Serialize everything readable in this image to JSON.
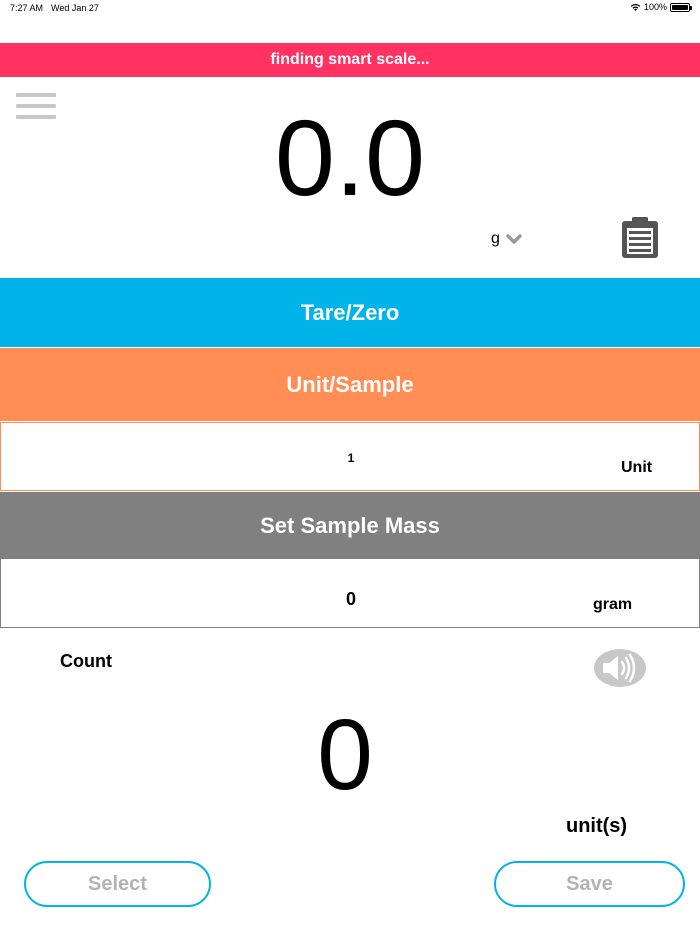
{
  "status_bar": {
    "time": "7:27 AM",
    "date": "Wed Jan 27",
    "battery": "100%"
  },
  "banner": {
    "text": "finding smart scale..."
  },
  "scale": {
    "reading": "0.0",
    "unit": "g"
  },
  "buttons": {
    "tare": "Tare/Zero",
    "unit_sample": "Unit/Sample",
    "set_sample_mass": "Set Sample Mass",
    "select": "Select",
    "save": "Save"
  },
  "unit_field": {
    "value": "1",
    "unit": "Unit"
  },
  "mass_field": {
    "value": "0",
    "unit": "gram"
  },
  "count": {
    "label": "Count",
    "value": "0",
    "unit": "unit(s)"
  },
  "icons": {
    "menu": "hamburger-icon",
    "clipboard": "clipboard-icon",
    "speaker": "speaker-icon",
    "chevron": "chevron-down-icon",
    "wifi": "wifi-icon",
    "battery": "battery-icon"
  },
  "colors": {
    "banner": "#ff3262",
    "tare": "#00b4e9",
    "unit_sample": "#ff8d54",
    "set_mass": "#808080",
    "pill_border": "#00b4e9"
  }
}
